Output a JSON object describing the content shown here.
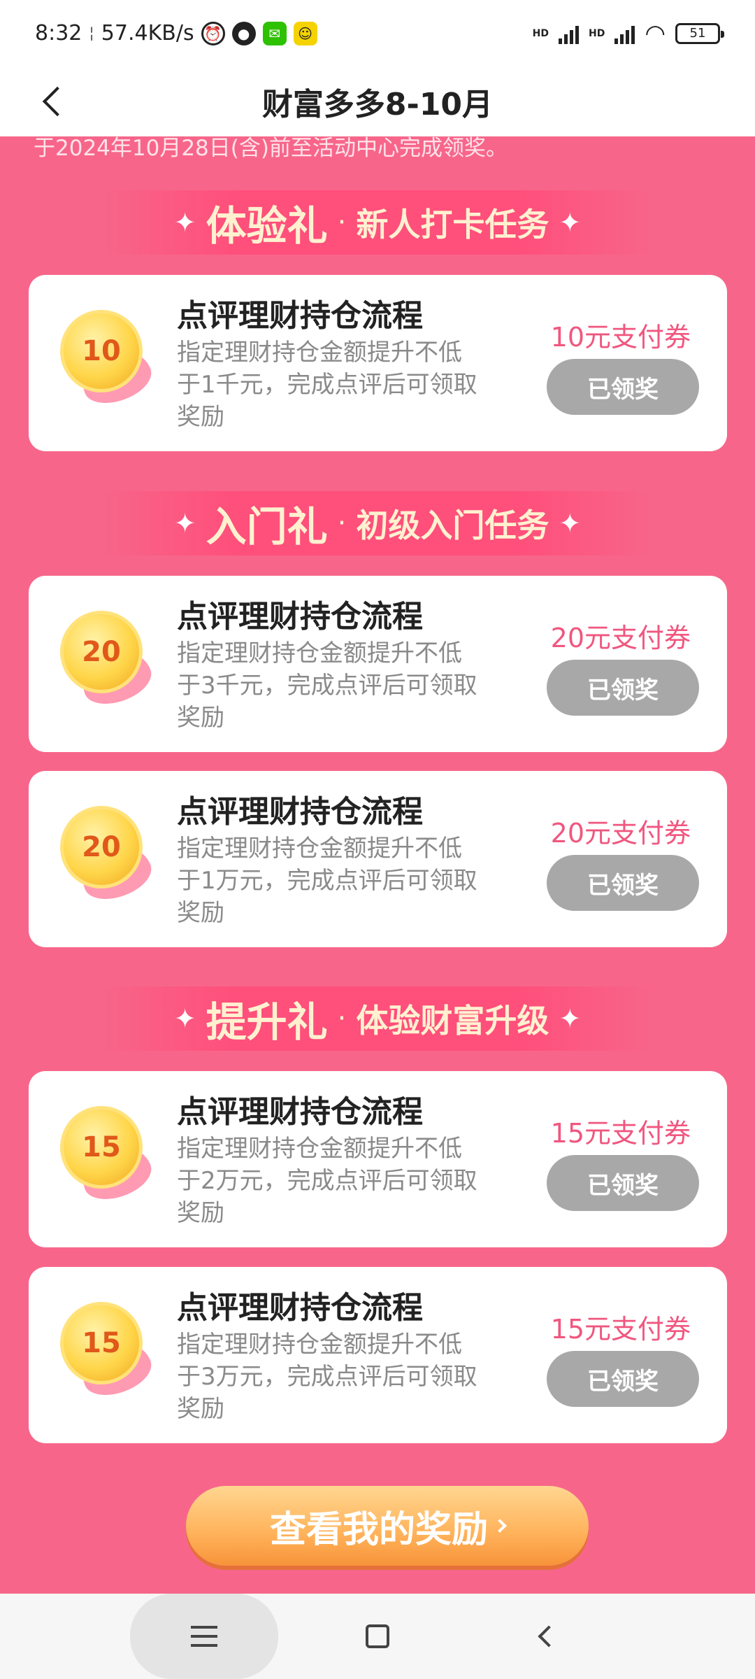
{
  "status_bar": {
    "time": "8:32",
    "network_speed": "57.4KB/s",
    "battery": "51",
    "hd1": "HD",
    "hd2": "HD"
  },
  "nav": {
    "title": "财富多多8-10月"
  },
  "notice": "于2024年10月28日(含)前至活动中心完成领奖。",
  "sections": [
    {
      "main": "体验礼",
      "sub": "新人打卡任务"
    },
    {
      "main": "入门礼",
      "sub": "初级入门任务"
    },
    {
      "main": "提升礼",
      "sub": "体验财富升级"
    }
  ],
  "tasks": [
    {
      "coin": "10",
      "title": "点评理财持仓流程",
      "desc": "指定理财持仓金额提升不低于1千元，完成点评后可领取奖励",
      "reward": "10元支付券",
      "button": "已领奖"
    },
    {
      "coin": "20",
      "title": "点评理财持仓流程",
      "desc": "指定理财持仓金额提升不低于3千元，完成点评后可领取奖励",
      "reward": "20元支付券",
      "button": "已领奖"
    },
    {
      "coin": "20",
      "title": "点评理财持仓流程",
      "desc": "指定理财持仓金额提升不低于1万元，完成点评后可领取奖励",
      "reward": "20元支付券",
      "button": "已领奖"
    },
    {
      "coin": "15",
      "title": "点评理财持仓流程",
      "desc": "指定理财持仓金额提升不低于2万元，完成点评后可领取奖励",
      "reward": "15元支付券",
      "button": "已领奖"
    },
    {
      "coin": "15",
      "title": "点评理财持仓流程",
      "desc": "指定理财持仓金额提升不低于3万元，完成点评后可领取奖励",
      "reward": "15元支付券",
      "button": "已领奖"
    }
  ],
  "view_rewards": "查看我的奖励",
  "colors": {
    "background": "#f7668a",
    "reward_text": "#f0577f",
    "claimed_button": "#a8a8a8",
    "cta_orange": "#ffb25a"
  },
  "icons": [
    "back-icon",
    "alarm-icon",
    "wechat-icon",
    "signal-icon",
    "wifi-icon",
    "battery-icon",
    "coin-icon",
    "menu-icon",
    "home-icon",
    "system-back-icon"
  ]
}
